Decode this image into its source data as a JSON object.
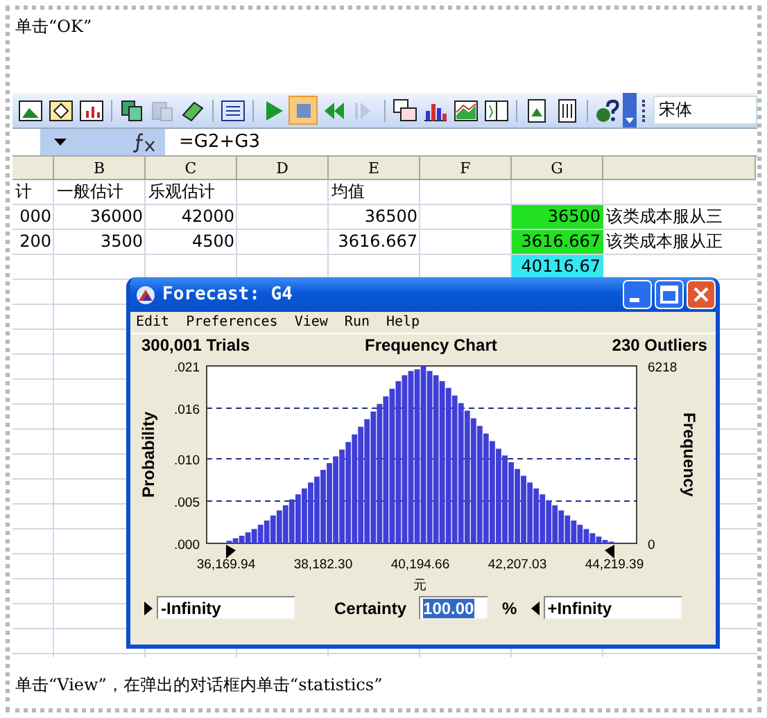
{
  "caption_top": "单击“OK”",
  "toolbar": {
    "buttons": [
      {
        "kind": "chart"
      },
      {
        "kind": "diamond"
      },
      {
        "kind": "bars"
      },
      {
        "kind": "separator"
      },
      {
        "kind": "copy"
      },
      {
        "kind": "paste",
        "disabled": true
      },
      {
        "kind": "eraser"
      },
      {
        "kind": "separator"
      },
      {
        "kind": "list"
      },
      {
        "kind": "separator"
      },
      {
        "kind": "play"
      },
      {
        "kind": "stop",
        "pressed": true
      },
      {
        "kind": "rewind"
      },
      {
        "kind": "step",
        "disabled": true
      },
      {
        "kind": "separator"
      },
      {
        "kind": "windows"
      },
      {
        "kind": "hist"
      },
      {
        "kind": "area"
      },
      {
        "kind": "split"
      },
      {
        "kind": "separator"
      },
      {
        "kind": "pdoc"
      },
      {
        "kind": "doc2"
      },
      {
        "kind": "separator"
      },
      {
        "kind": "help"
      }
    ],
    "font_name": "宋体"
  },
  "formula_bar": {
    "formula": "=G2+G3"
  },
  "sheet": {
    "columns": [
      "B",
      "C",
      "D",
      "E",
      "F",
      "G"
    ],
    "rows": [
      {
        "cells": {
          "lead": "计",
          "B": "一般估计",
          "C": "乐观估计",
          "E": "均值"
        }
      },
      {
        "cells": {
          "lead": "000",
          "B": "36000",
          "C": "42000",
          "E": "36500",
          "G": {
            "text": "36500",
            "color": "#22e022"
          },
          "trail": "该类成本服从三"
        }
      },
      {
        "cells": {
          "lead": "200",
          "B": "3500",
          "C": "4500",
          "E": "3616.667",
          "G": {
            "text": "3616.667",
            "color": "#22e022"
          },
          "trail": "该类成本服从正"
        }
      },
      {
        "cells": {
          "G": {
            "text": "40116.67",
            "color": "#33e8f0"
          }
        }
      }
    ]
  },
  "forecast_window": {
    "title": "Forecast: G4",
    "menu": [
      "Edit",
      "Preferences",
      "View",
      "Run",
      "Help"
    ],
    "trials": "300,001 Trials",
    "outliers": "230 Outliers",
    "chart_data": {
      "type": "bar",
      "title": "Frequency Chart",
      "xlabel": "元",
      "ylabel": "Probability",
      "grid": true,
      "xlim": [
        35767.47,
        44679.36
      ],
      "ylim": [
        0,
        0.021
      ],
      "xticks": [
        {
          "value": 36169.94,
          "label": "36,169.94"
        },
        {
          "value": 38182.3,
          "label": "38,182.30"
        },
        {
          "value": 40194.66,
          "label": "40,194.66"
        },
        {
          "value": 42207.03,
          "label": "42,207.03"
        },
        {
          "value": 44219.39,
          "label": "44,219.39"
        }
      ],
      "yticks": [
        {
          "value": 0,
          "label": ".000"
        },
        {
          "value": 0.005,
          "label": ".005"
        },
        {
          "value": 0.01,
          "label": ".010"
        },
        {
          "value": 0.016,
          "label": ".016"
        },
        {
          "value": 0.021,
          "label": ".021"
        }
      ],
      "x": [
        36235,
        36365,
        36495,
        36624,
        36754,
        36884,
        37014,
        37144,
        37274,
        37403,
        37533,
        37663,
        37793,
        37923,
        38053,
        38182,
        38312,
        38442,
        38572,
        38702,
        38832,
        38961,
        39091,
        39221,
        39351,
        39481,
        39611,
        39740,
        39870,
        40000,
        40130,
        40260,
        40390,
        40520,
        40649,
        40779,
        40909,
        41039,
        41169,
        41299,
        41428,
        41558,
        41688,
        41818,
        41948,
        42078,
        42207,
        42337,
        42467,
        42597,
        42727,
        42857,
        42986,
        43116,
        43246,
        43376,
        43506,
        43636,
        43765,
        43895,
        44025,
        44155
      ],
      "values": [
        0.0003,
        0.0006,
        0.0009,
        0.0013,
        0.0017,
        0.0022,
        0.0027,
        0.0033,
        0.0039,
        0.0045,
        0.0052,
        0.0058,
        0.0065,
        0.0072,
        0.0079,
        0.0087,
        0.0095,
        0.0103,
        0.0111,
        0.012,
        0.0129,
        0.0138,
        0.0147,
        0.0156,
        0.0165,
        0.0174,
        0.0183,
        0.0192,
        0.0199,
        0.0204,
        0.0206,
        0.021,
        0.0204,
        0.0199,
        0.0192,
        0.0184,
        0.0175,
        0.0166,
        0.0157,
        0.0148,
        0.0139,
        0.013,
        0.0121,
        0.0112,
        0.0104,
        0.0096,
        0.0088,
        0.008,
        0.0072,
        0.0065,
        0.0058,
        0.0051,
        0.0045,
        0.0039,
        0.0033,
        0.0027,
        0.0022,
        0.0017,
        0.0012,
        0.0008,
        0.0004,
        0.0002
      ]
    },
    "secondary_axis": {
      "label": "Frequency",
      "ticks": [
        "6218",
        "0"
      ]
    },
    "lower_bound": "-Infinity",
    "certainty_label": "Certainty",
    "certainty": "100.00",
    "percent": "%",
    "upper_bound": "+Infinity"
  },
  "caption_bottom": "单击“View”，在弹出的对话框内单击“statistics”"
}
